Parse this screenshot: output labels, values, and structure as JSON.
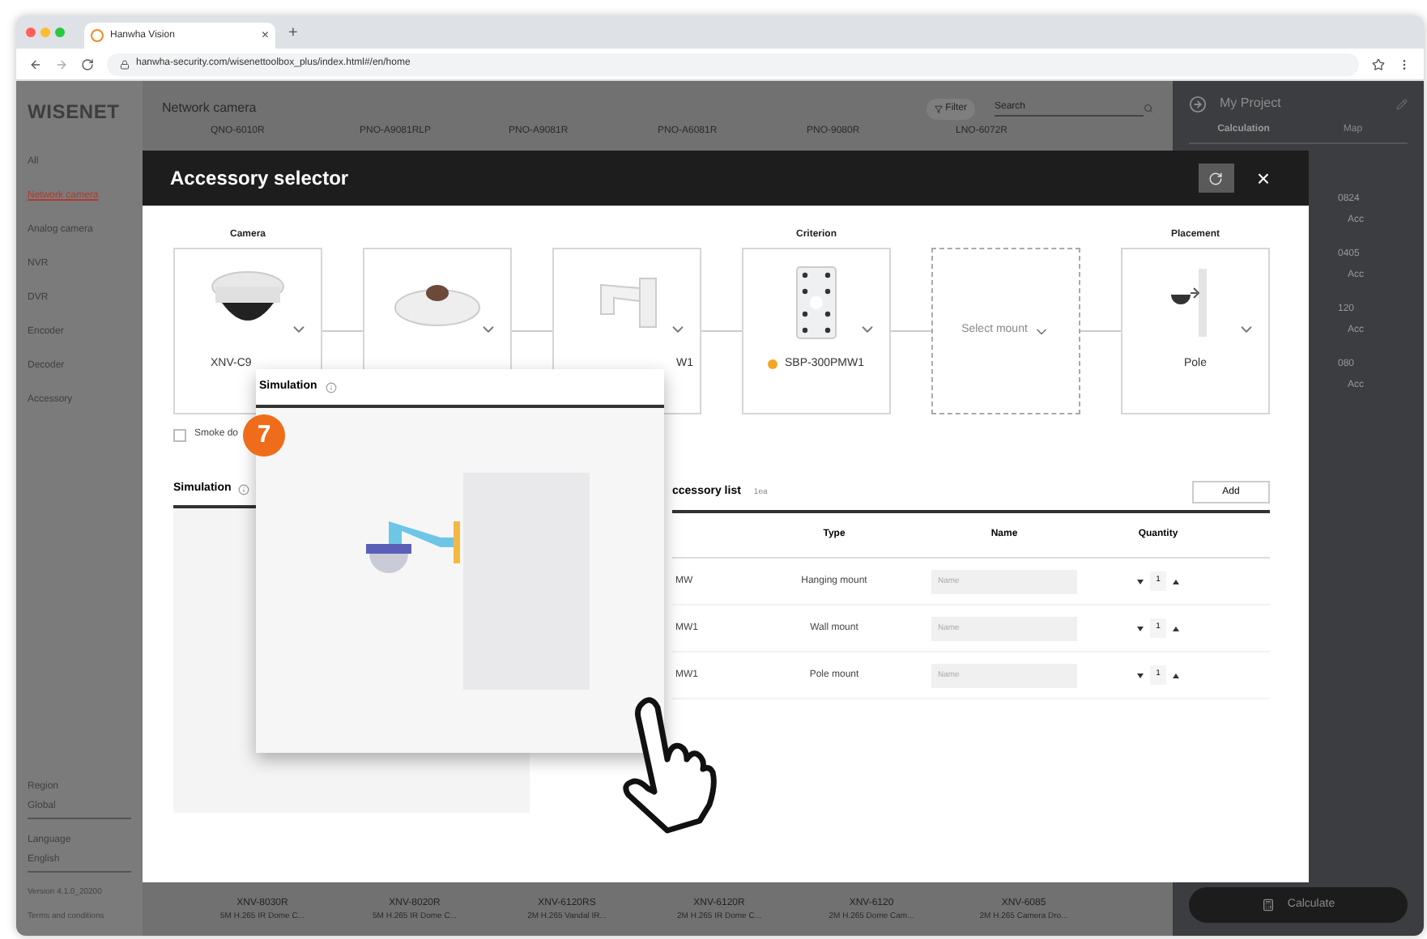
{
  "browser": {
    "tab_title": "Hanwha Vision",
    "tab_close": "×",
    "new_tab": "+",
    "url": "hanwha-security.com/wisenettoolbox_plus/index.html#/en/home"
  },
  "sidebar": {
    "logo": "WISENET",
    "items": [
      {
        "label": "All",
        "selected": false
      },
      {
        "label": "Network camera",
        "selected": true
      },
      {
        "label": "Analog camera",
        "selected": false
      },
      {
        "label": "NVR",
        "selected": false
      },
      {
        "label": "DVR",
        "selected": false
      },
      {
        "label": "Encoder",
        "selected": false
      },
      {
        "label": "Decoder",
        "selected": false
      },
      {
        "label": "Accessory",
        "selected": false
      }
    ],
    "region_label": "Region",
    "region_value": "Global",
    "language_label": "Language",
    "language_value": "English",
    "version": "Version 4.1.0_20200",
    "terms": "Terms and conditions"
  },
  "main": {
    "title": "Network camera",
    "filter": "Filter",
    "search_placeholder": "Search",
    "top_models": [
      "QNO-6010R",
      "PNO-A9081RLP",
      "PNO-A9081R",
      "PNO-A6081R",
      "PNO-9080R",
      "LNO-6072R"
    ],
    "bottom_models": [
      {
        "name": "XNV-8030R",
        "desc": "5M H.265 IR Dome C..."
      },
      {
        "name": "XNV-8020R",
        "desc": "5M H.265 IR Dome C..."
      },
      {
        "name": "XNV-6120RS",
        "desc": "2M H.265 Vandal IR..."
      },
      {
        "name": "XNV-6120R",
        "desc": "2M H.265 IR Dome C..."
      },
      {
        "name": "XNV-6120",
        "desc": "2M H.265 Dome Cam..."
      },
      {
        "name": "XNV-6085",
        "desc": "2M H.265 Camera Dro..."
      }
    ]
  },
  "project": {
    "title": "My Project",
    "tabs": [
      {
        "label": "Calculation",
        "selected": true
      },
      {
        "label": "Map",
        "selected": false
      }
    ],
    "items": [
      {
        "code": "0824",
        "action": "Acc"
      },
      {
        "code": "0405",
        "action": "Acc"
      },
      {
        "code": "120",
        "action": "Acc"
      },
      {
        "code": "080",
        "action": "Acc"
      }
    ],
    "calculate": "Calculate"
  },
  "modal": {
    "title": "Accessory selector",
    "close": "×",
    "cards": [
      {
        "kind": "camera",
        "step_label": "Camera",
        "label": "XNV-C9"
      },
      {
        "kind": "cap"
      },
      {
        "kind": "bracket",
        "label": "W1"
      },
      {
        "kind": "plate",
        "step_label": "Criterion",
        "label": "SBP-300PMW1",
        "color": "#f5a623"
      },
      {
        "kind": "empty",
        "label": "Select mount"
      },
      {
        "kind": "pole",
        "step_label": "Placement",
        "label": "Pole"
      }
    ],
    "checkbox": {
      "label": "Smoke do",
      "checked": false
    },
    "simulation_title": "Simulation",
    "accessory_title": "ccessory list",
    "accessory_count": "1ea",
    "add": "Add",
    "columns": [
      "Type",
      "Name",
      "Quantity"
    ],
    "rows": [
      {
        "code": "MW",
        "type": "Hanging mount",
        "name_placeholder": "Name",
        "quantity": "1"
      },
      {
        "code": "MW1",
        "type": "Wall mount",
        "name_placeholder": "Name",
        "quantity": "1"
      },
      {
        "code": "MW1",
        "type": "Pole mount",
        "name_placeholder": "Name",
        "quantity": "1"
      }
    ]
  },
  "popup": {
    "title": "Simulation",
    "step": "7"
  }
}
